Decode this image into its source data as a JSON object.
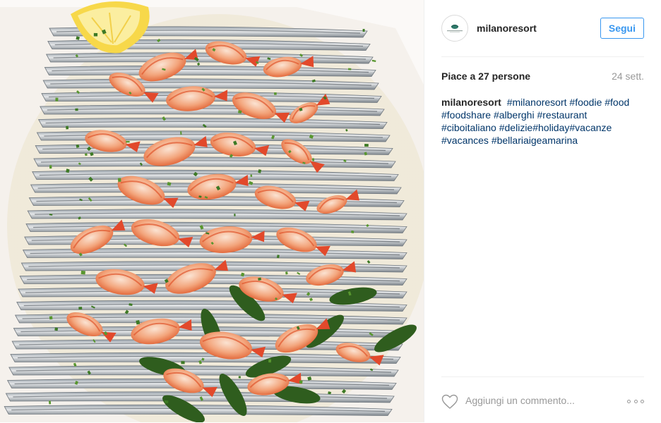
{
  "post": {
    "image_alt": "Piatto di gamberi e alici",
    "user": {
      "username": "milanoresort",
      "avatar_icon": "resort-logo-icon"
    },
    "follow_label": "Segui",
    "likes_text": "Piace a 27 persone",
    "time_text": "24 sett.",
    "caption": {
      "username": "milanoresort",
      "hashtags": [
        "#milanoresort",
        "#foodie",
        "#food",
        "#foodshare",
        "#alberghi",
        "#restaurant",
        "#ciboitaliano",
        "#delizie",
        "#holiday",
        "#vacanze",
        "#vacances",
        "#bellariaigeamarina"
      ]
    },
    "comment": {
      "placeholder": "Aggiungi un commento..."
    },
    "icons": {
      "like": "heart-outline-icon",
      "more": "more-options-icon"
    }
  },
  "colors": {
    "link": "#003569",
    "follow": "#3897f0",
    "muted": "#999999",
    "border": "#efefef"
  }
}
